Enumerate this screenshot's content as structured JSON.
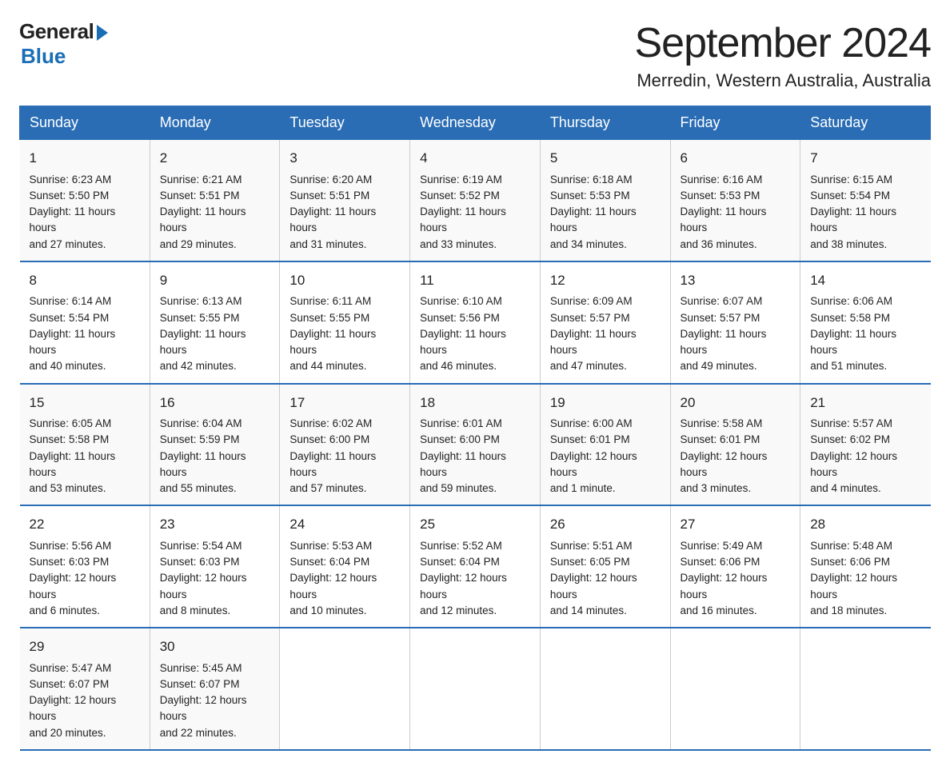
{
  "header": {
    "logo_general": "General",
    "logo_blue": "Blue",
    "month_title": "September 2024",
    "location": "Merredin, Western Australia, Australia"
  },
  "days_of_week": [
    "Sunday",
    "Monday",
    "Tuesday",
    "Wednesday",
    "Thursday",
    "Friday",
    "Saturday"
  ],
  "weeks": [
    [
      {
        "day": "1",
        "sunrise": "6:23 AM",
        "sunset": "5:50 PM",
        "daylight": "11 hours and 27 minutes."
      },
      {
        "day": "2",
        "sunrise": "6:21 AM",
        "sunset": "5:51 PM",
        "daylight": "11 hours and 29 minutes."
      },
      {
        "day": "3",
        "sunrise": "6:20 AM",
        "sunset": "5:51 PM",
        "daylight": "11 hours and 31 minutes."
      },
      {
        "day": "4",
        "sunrise": "6:19 AM",
        "sunset": "5:52 PM",
        "daylight": "11 hours and 33 minutes."
      },
      {
        "day": "5",
        "sunrise": "6:18 AM",
        "sunset": "5:53 PM",
        "daylight": "11 hours and 34 minutes."
      },
      {
        "day": "6",
        "sunrise": "6:16 AM",
        "sunset": "5:53 PM",
        "daylight": "11 hours and 36 minutes."
      },
      {
        "day": "7",
        "sunrise": "6:15 AM",
        "sunset": "5:54 PM",
        "daylight": "11 hours and 38 minutes."
      }
    ],
    [
      {
        "day": "8",
        "sunrise": "6:14 AM",
        "sunset": "5:54 PM",
        "daylight": "11 hours and 40 minutes."
      },
      {
        "day": "9",
        "sunrise": "6:13 AM",
        "sunset": "5:55 PM",
        "daylight": "11 hours and 42 minutes."
      },
      {
        "day": "10",
        "sunrise": "6:11 AM",
        "sunset": "5:55 PM",
        "daylight": "11 hours and 44 minutes."
      },
      {
        "day": "11",
        "sunrise": "6:10 AM",
        "sunset": "5:56 PM",
        "daylight": "11 hours and 46 minutes."
      },
      {
        "day": "12",
        "sunrise": "6:09 AM",
        "sunset": "5:57 PM",
        "daylight": "11 hours and 47 minutes."
      },
      {
        "day": "13",
        "sunrise": "6:07 AM",
        "sunset": "5:57 PM",
        "daylight": "11 hours and 49 minutes."
      },
      {
        "day": "14",
        "sunrise": "6:06 AM",
        "sunset": "5:58 PM",
        "daylight": "11 hours and 51 minutes."
      }
    ],
    [
      {
        "day": "15",
        "sunrise": "6:05 AM",
        "sunset": "5:58 PM",
        "daylight": "11 hours and 53 minutes."
      },
      {
        "day": "16",
        "sunrise": "6:04 AM",
        "sunset": "5:59 PM",
        "daylight": "11 hours and 55 minutes."
      },
      {
        "day": "17",
        "sunrise": "6:02 AM",
        "sunset": "6:00 PM",
        "daylight": "11 hours and 57 minutes."
      },
      {
        "day": "18",
        "sunrise": "6:01 AM",
        "sunset": "6:00 PM",
        "daylight": "11 hours and 59 minutes."
      },
      {
        "day": "19",
        "sunrise": "6:00 AM",
        "sunset": "6:01 PM",
        "daylight": "12 hours and 1 minute."
      },
      {
        "day": "20",
        "sunrise": "5:58 AM",
        "sunset": "6:01 PM",
        "daylight": "12 hours and 3 minutes."
      },
      {
        "day": "21",
        "sunrise": "5:57 AM",
        "sunset": "6:02 PM",
        "daylight": "12 hours and 4 minutes."
      }
    ],
    [
      {
        "day": "22",
        "sunrise": "5:56 AM",
        "sunset": "6:03 PM",
        "daylight": "12 hours and 6 minutes."
      },
      {
        "day": "23",
        "sunrise": "5:54 AM",
        "sunset": "6:03 PM",
        "daylight": "12 hours and 8 minutes."
      },
      {
        "day": "24",
        "sunrise": "5:53 AM",
        "sunset": "6:04 PM",
        "daylight": "12 hours and 10 minutes."
      },
      {
        "day": "25",
        "sunrise": "5:52 AM",
        "sunset": "6:04 PM",
        "daylight": "12 hours and 12 minutes."
      },
      {
        "day": "26",
        "sunrise": "5:51 AM",
        "sunset": "6:05 PM",
        "daylight": "12 hours and 14 minutes."
      },
      {
        "day": "27",
        "sunrise": "5:49 AM",
        "sunset": "6:06 PM",
        "daylight": "12 hours and 16 minutes."
      },
      {
        "day": "28",
        "sunrise": "5:48 AM",
        "sunset": "6:06 PM",
        "daylight": "12 hours and 18 minutes."
      }
    ],
    [
      {
        "day": "29",
        "sunrise": "5:47 AM",
        "sunset": "6:07 PM",
        "daylight": "12 hours and 20 minutes."
      },
      {
        "day": "30",
        "sunrise": "5:45 AM",
        "sunset": "6:07 PM",
        "daylight": "12 hours and 22 minutes."
      },
      null,
      null,
      null,
      null,
      null
    ]
  ],
  "labels": {
    "sunrise": "Sunrise:",
    "sunset": "Sunset:",
    "daylight": "Daylight:"
  }
}
